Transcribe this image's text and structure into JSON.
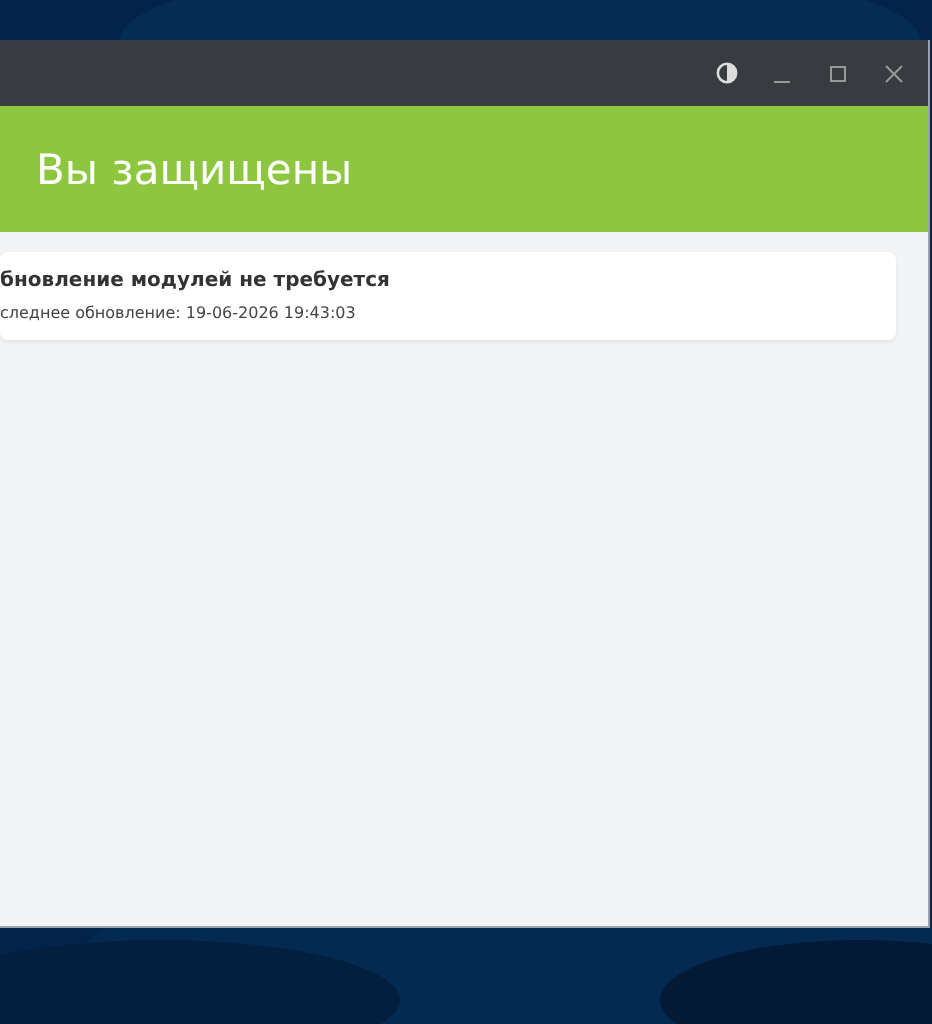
{
  "banner": {
    "title": "Вы защищены"
  },
  "status_card": {
    "title": "бновление модулей не требуется",
    "subtitle": "следнее обновление: 19-06-2026 19:43:03"
  }
}
